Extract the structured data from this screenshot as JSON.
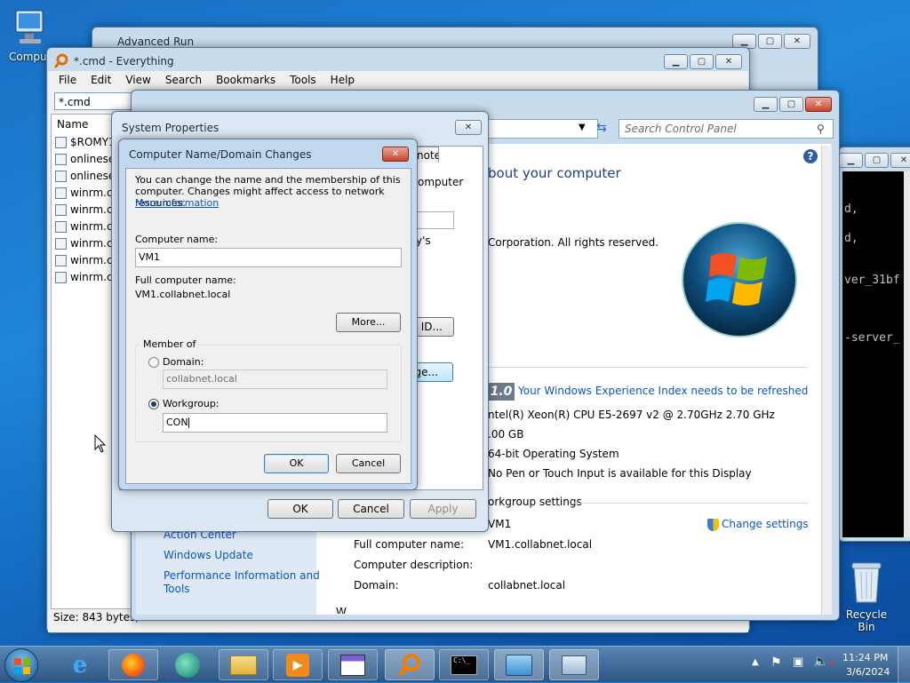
{
  "desktop": {
    "computer_label": "Compu",
    "recycle_label": "Recycle Bin"
  },
  "advanced_run": {
    "title": "Advanced Run"
  },
  "everything": {
    "title": "*.cmd - Everything",
    "menu": [
      "File",
      "Edit",
      "View",
      "Search",
      "Bookmarks",
      "Tools",
      "Help"
    ],
    "search_value": "*.cmd",
    "column_name": "Name",
    "files": [
      "$ROMY1",
      "onlinese",
      "onlinese",
      "winrm.c",
      "winrm.c",
      "winrm.c",
      "winrm.c",
      "winrm.c",
      "winrm.c"
    ],
    "status": "Size: 843 bytes, D"
  },
  "control_panel": {
    "search_placeholder": "Search Control Panel",
    "heading": "bout your computer",
    "copyright": "Corporation.  All rights reserved.",
    "rating_score": "1.0",
    "rating_link": "Your Windows Experience Index needs to be refreshed",
    "processor": "ntel(R) Xeon(R) CPU E5-2697 v2 @ 2.70GHz   2.70 GHz",
    "memory": ".00 GB",
    "system_type": "64-bit Operating System",
    "pen_touch": "No Pen or Touch Input is available for this Display",
    "workgroup_header": "orkgroup settings",
    "computer_name_value": "VM1",
    "change_settings": "Change settings",
    "full_name_label": "Full computer name:",
    "full_name_value": "VM1.collabnet.local",
    "description_label": "Computer description:",
    "domain_label": "Domain:",
    "domain_value": "collabnet.local",
    "see_also": [
      "Action Center",
      "Windows Update",
      "Performance Information and",
      "Tools"
    ],
    "partial_bottom": "W"
  },
  "console": {
    "lines": [
      "d,",
      "d,",
      "ver_31bf",
      "-server_"
    ]
  },
  "system_properties": {
    "title": "System Properties",
    "tab_partial": "note",
    "computer_partial": "omputer",
    "partial_ys": "y's",
    "network_id_partial": "k ID...",
    "change_partial": "ge...",
    "ok": "OK",
    "cancel": "Cancel",
    "apply": "Apply"
  },
  "dialog": {
    "title": "Computer Name/Domain Changes",
    "description": "You can change the name and the membership of this computer. Changes might affect access to network resources.",
    "more_info": "More information",
    "computer_name_label": "Computer name:",
    "computer_name_value": "VM1",
    "full_name_label": "Full computer name:",
    "full_name_value": "VM1.collabnet.local",
    "more_button": "More...",
    "member_of": "Member of",
    "domain_label": "Domain:",
    "domain_value": "collabnet.local",
    "workgroup_label": "Workgroup:",
    "workgroup_value": "CON",
    "ok": "OK",
    "cancel": "Cancel"
  },
  "taskbar": {
    "time": "11:24 PM",
    "date": "3/6/2024"
  }
}
